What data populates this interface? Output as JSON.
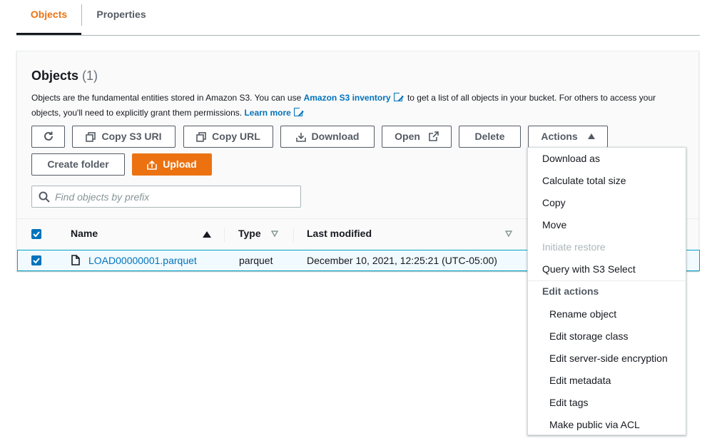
{
  "tabs": [
    {
      "label": "Objects",
      "active": true
    },
    {
      "label": "Properties",
      "active": false
    }
  ],
  "panel": {
    "title": "Objects",
    "count": "(1)",
    "description": {
      "part1": "Objects are the fundamental entities stored in Amazon S3. You can use ",
      "link1": "Amazon S3 inventory",
      "part2": " to get a list of all objects in your bucket. For others to access your objects, you'll need to explicitly grant them permissions. ",
      "link2": "Learn more"
    }
  },
  "toolbar": {
    "copy_s3_uri": "Copy S3 URI",
    "copy_url": "Copy URL",
    "download": "Download",
    "open": "Open",
    "delete": "Delete",
    "actions": "Actions",
    "create_folder": "Create folder",
    "upload": "Upload"
  },
  "search": {
    "placeholder": "Find objects by prefix",
    "value": ""
  },
  "table": {
    "columns": {
      "name": "Name",
      "type": "Type",
      "last_modified": "Last modified"
    },
    "rows": [
      {
        "name": "LOAD00000001.parquet",
        "type": "parquet",
        "last_modified": "December 10, 2021, 12:25:21 (UTC-05:00)",
        "selected": true
      }
    ]
  },
  "actions_menu": {
    "items": [
      "Download as",
      "Calculate total size",
      "Copy",
      "Move",
      "Initiate restore",
      "Query with S3 Select"
    ],
    "disabled": [
      "Initiate restore"
    ],
    "group_label": "Edit actions",
    "group_items": [
      "Rename object",
      "Edit storage class",
      "Edit server-side encryption",
      "Edit metadata",
      "Edit tags",
      "Make public via ACL"
    ]
  },
  "colors": {
    "accent": "#ec7211",
    "link": "#0073bb",
    "text": "#16191f",
    "muted": "#545b64",
    "disabled": "#aab7b8"
  }
}
